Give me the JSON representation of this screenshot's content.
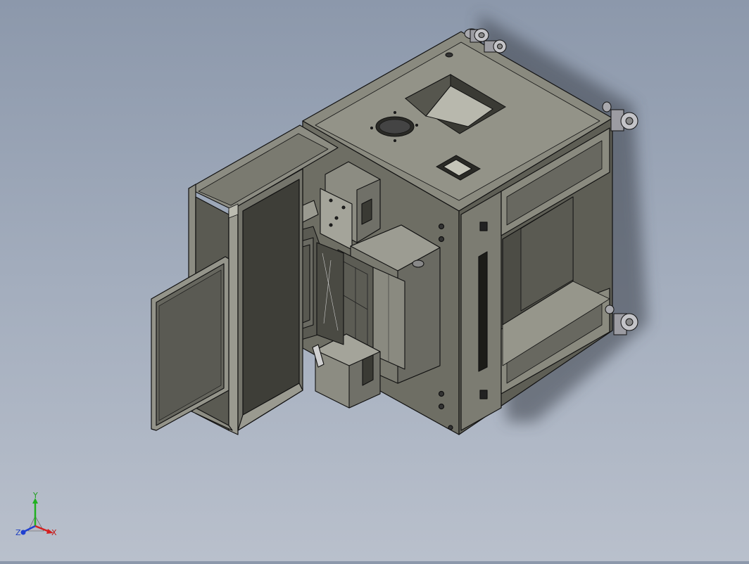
{
  "viewport": {
    "background_top": "#8c98ab",
    "background_bottom": "#b9c0cc",
    "model_color": "#7d7d72",
    "model_edge_color": "#111111"
  },
  "triad": {
    "x_label": "X",
    "y_label": "Y",
    "z_label": "Z",
    "x_color": "#d42020",
    "y_color": "#20b020",
    "z_color": "#2040d0"
  }
}
